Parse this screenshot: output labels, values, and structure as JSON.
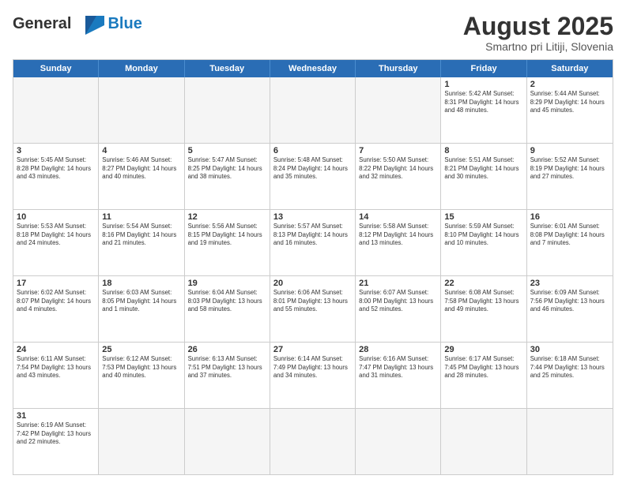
{
  "logo": {
    "general": "General",
    "blue": "Blue"
  },
  "title": "August 2025",
  "subtitle": "Smartno pri Litiji, Slovenia",
  "days": [
    "Sunday",
    "Monday",
    "Tuesday",
    "Wednesday",
    "Thursday",
    "Friday",
    "Saturday"
  ],
  "weeks": [
    [
      {
        "num": "",
        "info": "",
        "empty": true
      },
      {
        "num": "",
        "info": "",
        "empty": true
      },
      {
        "num": "",
        "info": "",
        "empty": true
      },
      {
        "num": "",
        "info": "",
        "empty": true
      },
      {
        "num": "",
        "info": "",
        "empty": true
      },
      {
        "num": "1",
        "info": "Sunrise: 5:42 AM\nSunset: 8:31 PM\nDaylight: 14 hours and 48 minutes."
      },
      {
        "num": "2",
        "info": "Sunrise: 5:44 AM\nSunset: 8:29 PM\nDaylight: 14 hours and 45 minutes."
      }
    ],
    [
      {
        "num": "3",
        "info": "Sunrise: 5:45 AM\nSunset: 8:28 PM\nDaylight: 14 hours and 43 minutes."
      },
      {
        "num": "4",
        "info": "Sunrise: 5:46 AM\nSunset: 8:27 PM\nDaylight: 14 hours and 40 minutes."
      },
      {
        "num": "5",
        "info": "Sunrise: 5:47 AM\nSunset: 8:25 PM\nDaylight: 14 hours and 38 minutes."
      },
      {
        "num": "6",
        "info": "Sunrise: 5:48 AM\nSunset: 8:24 PM\nDaylight: 14 hours and 35 minutes."
      },
      {
        "num": "7",
        "info": "Sunrise: 5:50 AM\nSunset: 8:22 PM\nDaylight: 14 hours and 32 minutes."
      },
      {
        "num": "8",
        "info": "Sunrise: 5:51 AM\nSunset: 8:21 PM\nDaylight: 14 hours and 30 minutes."
      },
      {
        "num": "9",
        "info": "Sunrise: 5:52 AM\nSunset: 8:19 PM\nDaylight: 14 hours and 27 minutes."
      }
    ],
    [
      {
        "num": "10",
        "info": "Sunrise: 5:53 AM\nSunset: 8:18 PM\nDaylight: 14 hours and 24 minutes."
      },
      {
        "num": "11",
        "info": "Sunrise: 5:54 AM\nSunset: 8:16 PM\nDaylight: 14 hours and 21 minutes."
      },
      {
        "num": "12",
        "info": "Sunrise: 5:56 AM\nSunset: 8:15 PM\nDaylight: 14 hours and 19 minutes."
      },
      {
        "num": "13",
        "info": "Sunrise: 5:57 AM\nSunset: 8:13 PM\nDaylight: 14 hours and 16 minutes."
      },
      {
        "num": "14",
        "info": "Sunrise: 5:58 AM\nSunset: 8:12 PM\nDaylight: 14 hours and 13 minutes."
      },
      {
        "num": "15",
        "info": "Sunrise: 5:59 AM\nSunset: 8:10 PM\nDaylight: 14 hours and 10 minutes."
      },
      {
        "num": "16",
        "info": "Sunrise: 6:01 AM\nSunset: 8:08 PM\nDaylight: 14 hours and 7 minutes."
      }
    ],
    [
      {
        "num": "17",
        "info": "Sunrise: 6:02 AM\nSunset: 8:07 PM\nDaylight: 14 hours and 4 minutes."
      },
      {
        "num": "18",
        "info": "Sunrise: 6:03 AM\nSunset: 8:05 PM\nDaylight: 14 hours and 1 minute."
      },
      {
        "num": "19",
        "info": "Sunrise: 6:04 AM\nSunset: 8:03 PM\nDaylight: 13 hours and 58 minutes."
      },
      {
        "num": "20",
        "info": "Sunrise: 6:06 AM\nSunset: 8:01 PM\nDaylight: 13 hours and 55 minutes."
      },
      {
        "num": "21",
        "info": "Sunrise: 6:07 AM\nSunset: 8:00 PM\nDaylight: 13 hours and 52 minutes."
      },
      {
        "num": "22",
        "info": "Sunrise: 6:08 AM\nSunset: 7:58 PM\nDaylight: 13 hours and 49 minutes."
      },
      {
        "num": "23",
        "info": "Sunrise: 6:09 AM\nSunset: 7:56 PM\nDaylight: 13 hours and 46 minutes."
      }
    ],
    [
      {
        "num": "24",
        "info": "Sunrise: 6:11 AM\nSunset: 7:54 PM\nDaylight: 13 hours and 43 minutes."
      },
      {
        "num": "25",
        "info": "Sunrise: 6:12 AM\nSunset: 7:53 PM\nDaylight: 13 hours and 40 minutes."
      },
      {
        "num": "26",
        "info": "Sunrise: 6:13 AM\nSunset: 7:51 PM\nDaylight: 13 hours and 37 minutes."
      },
      {
        "num": "27",
        "info": "Sunrise: 6:14 AM\nSunset: 7:49 PM\nDaylight: 13 hours and 34 minutes."
      },
      {
        "num": "28",
        "info": "Sunrise: 6:16 AM\nSunset: 7:47 PM\nDaylight: 13 hours and 31 minutes."
      },
      {
        "num": "29",
        "info": "Sunrise: 6:17 AM\nSunset: 7:45 PM\nDaylight: 13 hours and 28 minutes."
      },
      {
        "num": "30",
        "info": "Sunrise: 6:18 AM\nSunset: 7:44 PM\nDaylight: 13 hours and 25 minutes."
      }
    ],
    [
      {
        "num": "31",
        "info": "Sunrise: 6:19 AM\nSunset: 7:42 PM\nDaylight: 13 hours and 22 minutes."
      },
      {
        "num": "",
        "info": "",
        "empty": true
      },
      {
        "num": "",
        "info": "",
        "empty": true
      },
      {
        "num": "",
        "info": "",
        "empty": true
      },
      {
        "num": "",
        "info": "",
        "empty": true
      },
      {
        "num": "",
        "info": "",
        "empty": true
      },
      {
        "num": "",
        "info": "",
        "empty": true
      }
    ]
  ]
}
